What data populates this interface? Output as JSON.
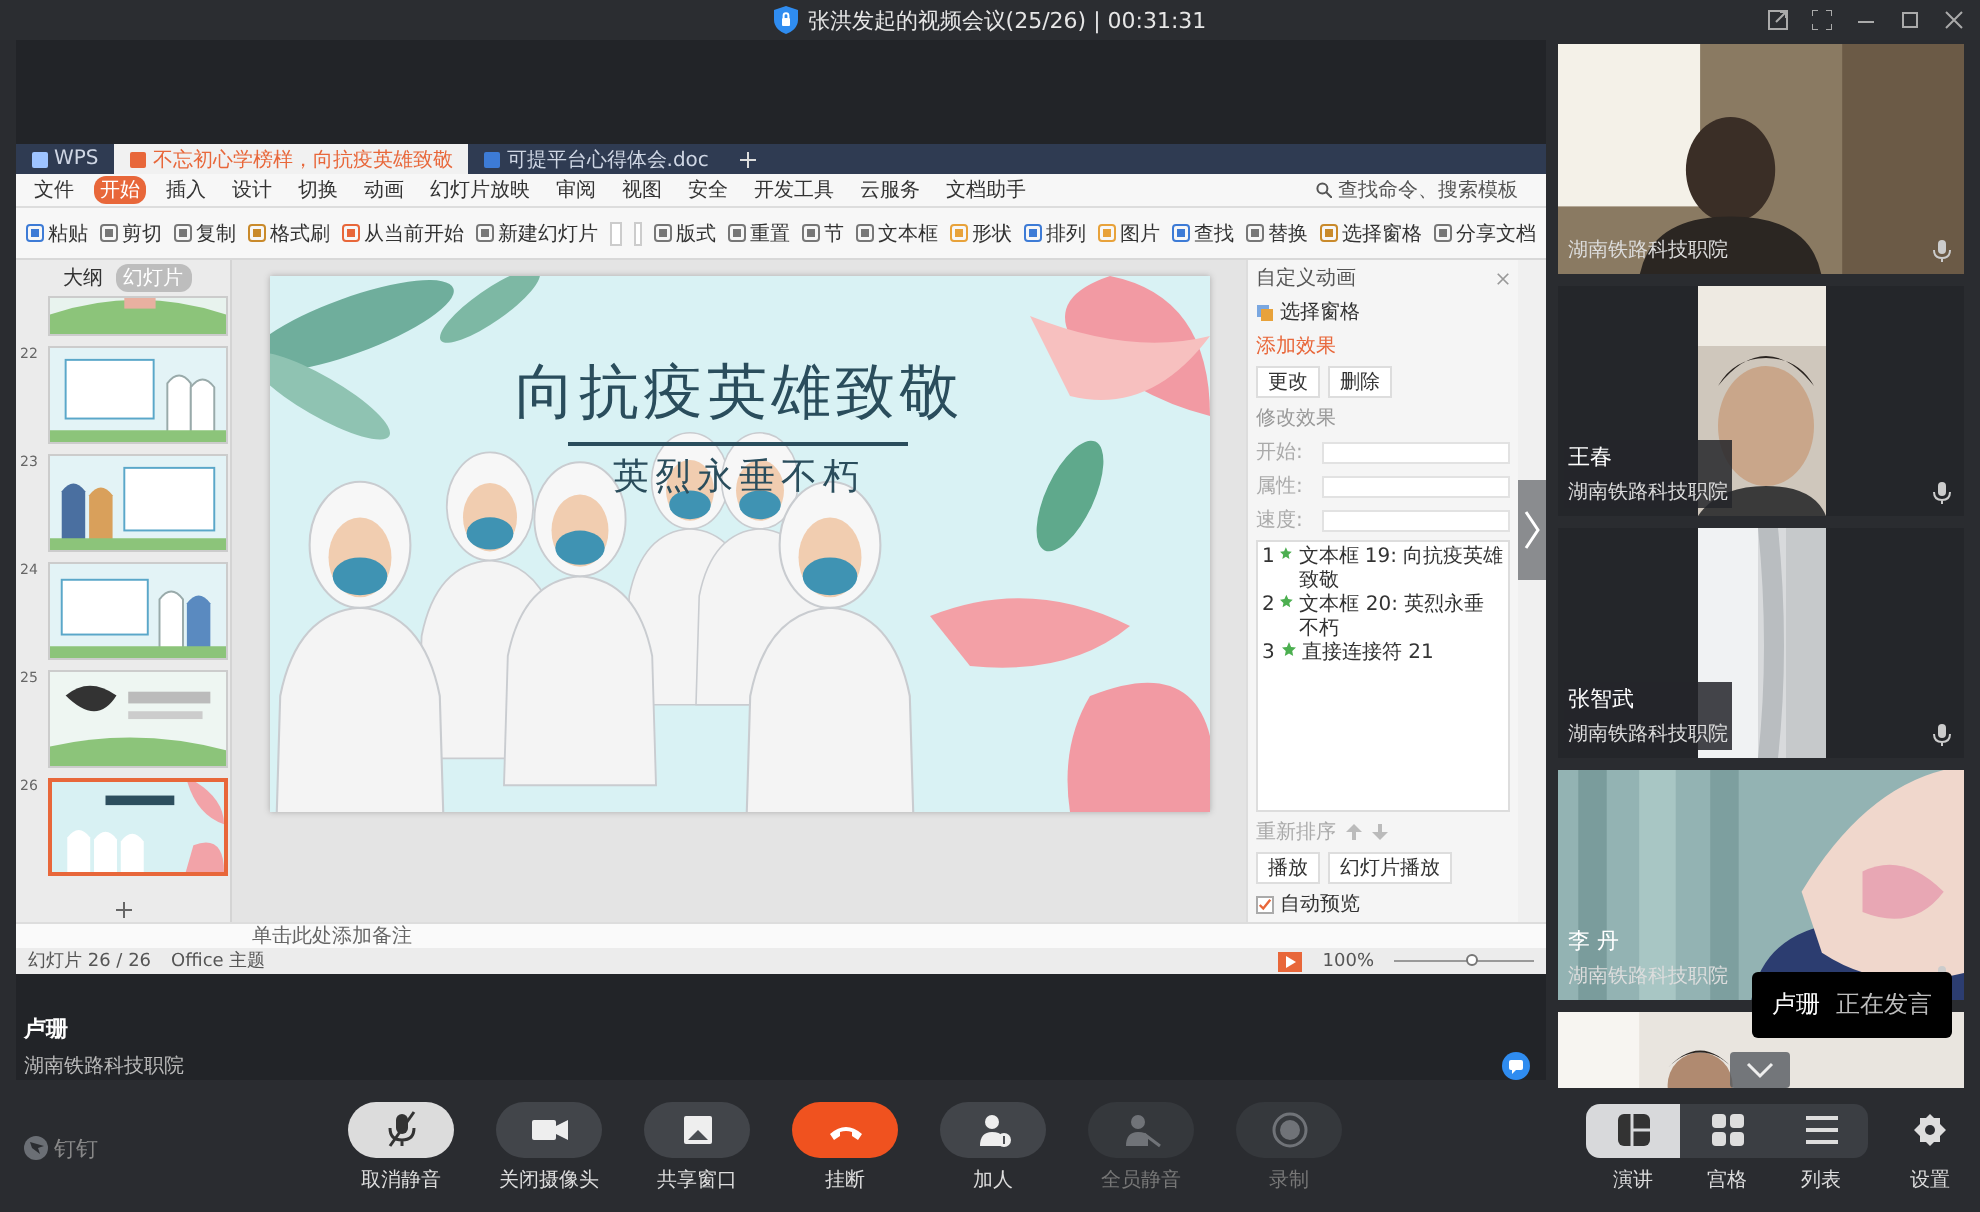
{
  "window": {
    "title": "张洪发起的视频会议(25/26) | 00:31:31"
  },
  "shared_screen": {
    "tabs": [
      {
        "label": "WPS",
        "selected": false
      },
      {
        "label": "不忘初心学榜样，向抗疫英雄致敬",
        "selected": true
      },
      {
        "label": "可提平台心得体会.doc",
        "selected": false
      }
    ],
    "menu": [
      {
        "label": "文件",
        "selected": false
      },
      {
        "label": "开始",
        "selected": true
      },
      {
        "label": "插入",
        "selected": false
      },
      {
        "label": "设计",
        "selected": false
      },
      {
        "label": "切换",
        "selected": false
      },
      {
        "label": "动画",
        "selected": false
      },
      {
        "label": "幻灯片放映",
        "selected": false
      },
      {
        "label": "审阅",
        "selected": false
      },
      {
        "label": "视图",
        "selected": false
      },
      {
        "label": "安全",
        "selected": false
      },
      {
        "label": "开发工具",
        "selected": false
      },
      {
        "label": "云服务",
        "selected": false
      },
      {
        "label": "文档助手",
        "selected": false
      }
    ],
    "search": {
      "placeholder": "查找命令、搜索模板"
    },
    "ribbon": [
      "粘贴",
      "剪切",
      "复制",
      "格式刷",
      "从当前开始",
      "新建幻灯片",
      "版式",
      "重置",
      "节",
      "文本框",
      "形状",
      "排列",
      "图片",
      "查找",
      "替换",
      "选择窗格",
      "分享文档"
    ],
    "side_tabs": [
      {
        "label": "大纲",
        "selected": false
      },
      {
        "label": "幻灯片",
        "selected": true
      }
    ],
    "thumbnails": [
      {
        "selected": false
      },
      {
        "number": "22",
        "selected": false
      },
      {
        "number": "23",
        "selected": false
      },
      {
        "number": "24",
        "selected": false
      },
      {
        "number": "25",
        "selected": false
      },
      {
        "number": "26",
        "selected": true
      }
    ],
    "slide": {
      "title": "向抗疫英雄致敬",
      "subtitle": "英烈永垂不朽"
    },
    "panel": {
      "title": "自定义动画",
      "selection_pane": "选择窗格",
      "add_effect": "添加效果",
      "buttons": [
        "更改",
        "删除"
      ],
      "section": "修改效果",
      "fields": [
        "开始:",
        "属性:",
        "速度:"
      ],
      "effects": [
        {
          "number": "1",
          "label": "文本框 19: 向抗疫英雄致敬"
        },
        {
          "number": "2",
          "label": "文本框 20: 英烈永垂不朽"
        },
        {
          "number": "3",
          "label": "直接连接符 21"
        }
      ],
      "reorder": "重新排序",
      "play_buttons": [
        "播放",
        "幻灯片播放"
      ],
      "auto_preview": {
        "label": "自动预览",
        "checked": true
      }
    },
    "notes_placeholder": "单击此处添加备注",
    "status": {
      "slide": "幻灯片 26 / 26",
      "theme": "Office 主题",
      "zoom": "100%",
      "zoom_slider": {
        "level": 0.55
      }
    }
  },
  "speaker": {
    "name": "卢珊",
    "org": "湖南铁路科技职院"
  },
  "participants": [
    {
      "kind": "wide",
      "org": "湖南铁路科技职院"
    },
    {
      "kind": "portrait",
      "name": "王春",
      "org": "湖南铁路科技职院"
    },
    {
      "kind": "portrait",
      "name": "张智武",
      "org": "湖南铁路科技职院"
    },
    {
      "kind": "wide",
      "name": "李 丹",
      "org": "湖南铁路科技职院"
    },
    {
      "kind": "partial"
    }
  ],
  "toast": {
    "name": "卢珊",
    "text": "正在发言"
  },
  "brand": "钉钉",
  "controls": [
    {
      "kind": "mic-off",
      "label": "取消静音",
      "selected": true,
      "disabled": false
    },
    {
      "kind": "camera",
      "label": "关闭摄像头",
      "selected": false,
      "disabled": false
    },
    {
      "kind": "share",
      "label": "共享窗口",
      "selected": false,
      "disabled": false
    },
    {
      "kind": "hangup",
      "label": "挂断",
      "selected": false,
      "disabled": false
    },
    {
      "kind": "add-person",
      "label": "加人",
      "selected": false,
      "disabled": false
    },
    {
      "kind": "mute-all",
      "label": "全员静音",
      "selected": false,
      "disabled": true
    },
    {
      "kind": "record",
      "label": "录制",
      "selected": false,
      "disabled": true
    }
  ],
  "views": [
    {
      "kind": "speaker",
      "label": "演讲",
      "selected": true
    },
    {
      "kind": "grid",
      "label": "宫格",
      "selected": false
    },
    {
      "kind": "list",
      "label": "列表",
      "selected": false
    }
  ],
  "settings": {
    "label": "设置"
  }
}
